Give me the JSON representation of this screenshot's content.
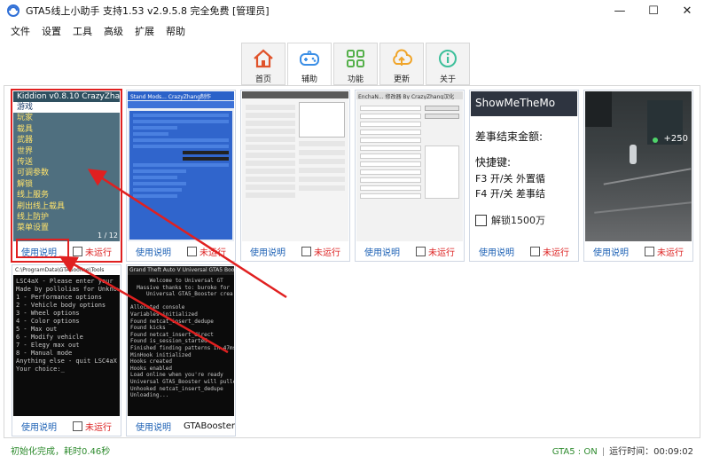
{
  "window": {
    "title": "GTA5线上小助手 支持1.53 v2.9.5.8 完全免费 [管理员]",
    "controls": [
      "—",
      "☐",
      "✕"
    ]
  },
  "menu": [
    "文件",
    "设置",
    "工具",
    "高级",
    "扩展",
    "帮助"
  ],
  "tabs": [
    {
      "label": "首页",
      "icon": "home-icon",
      "color": "#e0532b"
    },
    {
      "label": "辅助",
      "icon": "gamepad-icon",
      "color": "#3a8ee6"
    },
    {
      "label": "功能",
      "icon": "grid-icon",
      "color": "#55b04a"
    },
    {
      "label": "更新",
      "icon": "cloud-upload-icon",
      "color": "#f0a52a"
    },
    {
      "label": "关于",
      "icon": "info-icon",
      "color": "#3cbf9a"
    }
  ],
  "cards": [
    {
      "help": "使用说明",
      "status": "未运行",
      "kiddion": {
        "header": "Kiddion v0.8.10 CrazyZhang",
        "items": [
          "游戏",
          "玩家",
          "载具",
          "武器",
          "世界",
          "传送",
          "可调参数",
          "解锁",
          "线上服务",
          "刷出线上载具",
          "线上防护",
          "菜单设置"
        ],
        "page": "1 / 12"
      }
    },
    {
      "help": "使用说明",
      "status": "未运行",
      "header": "Stand Mods... CrazyZhang制作"
    },
    {
      "help": "使用说明",
      "status": "未运行"
    },
    {
      "help": "使用说明",
      "status": "未运行",
      "header": "EnchaN... 修改器 By CrazyZhang汉化"
    },
    {
      "help": "使用说明",
      "status": "未运行",
      "smtm": {
        "header": "ShowMeTheMo",
        "l1": "差事结束金额:",
        "l2": "快捷键:",
        "l3": "F3 开/关 外置循",
        "l4": "F4 开/关 差事结",
        "unlock": "解锁1500万"
      }
    },
    {
      "help": "使用说明",
      "status": "未运行",
      "hud": "+250"
    },
    {
      "help": "使用说明",
      "status": "未运行",
      "console_title": "C:\\ProgramData\\GTASooline\\Tools",
      "console": "LSC4aX - Please enter your\nMade by pollolias for Unknow\n1 - Performance options\n2 - Vehicle body options\n3 - Wheel options\n4 - Color options\n5 - Max out\n6 - Modify vehicle\n7 - Elegy max out\n8 - Manual mode\nAnything else - quit LSC4aX\nYour choice:_"
    },
    {
      "help": "使用说明",
      "name": "GTABooster",
      "console_title": "Grand Theft Auto V Universal GTA5 Booster",
      "console": "      Welcome to Universal GT\n  Massive thanks to: buroko for\n     Universal GTA5_Booster crea\n\nAllocated console\nVariables initialized\nFound netcat_insert_dedupe\nFound kicks\nFound netcat_insert_direct\nFound is_session_started\nFinished finding patterns in 47ms\nMinHook initialized\nHooks created\nHooks enabled\nLoad online when you're ready\nUniversal GTA5_Booster will pulled\nUnhooked netcat_insert_dedupe\nUnloading..."
    }
  ],
  "statusbar": {
    "left": "初始化完成，耗时0.46秒",
    "gta": "GTA5 : ON",
    "runtime": "运行时间：00:09:02"
  }
}
